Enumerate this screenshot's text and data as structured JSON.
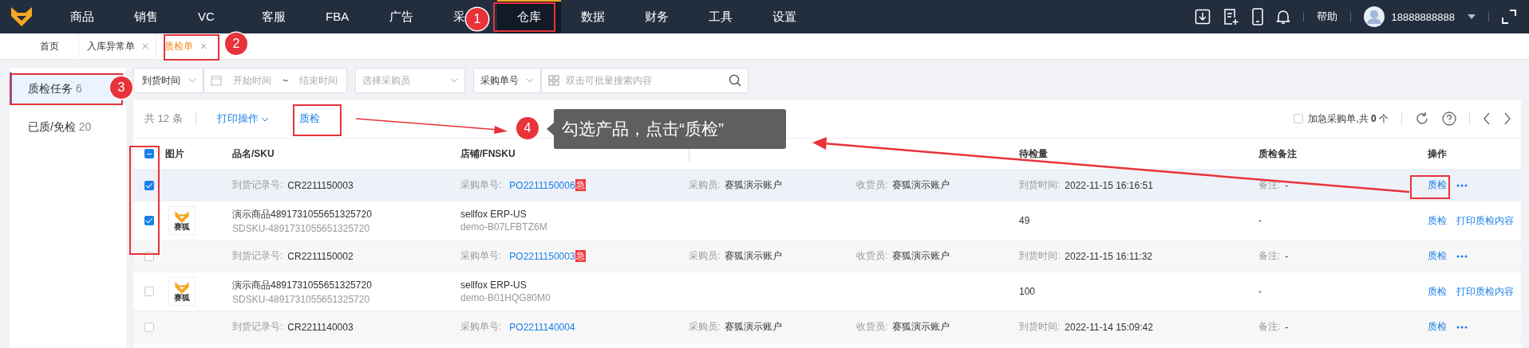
{
  "nav": {
    "items": [
      {
        "label": "商品",
        "selected": false
      },
      {
        "label": "销售",
        "selected": false
      },
      {
        "label": "VC",
        "selected": false
      },
      {
        "label": "客服",
        "selected": false
      },
      {
        "label": "FBA",
        "selected": false
      },
      {
        "label": "广告",
        "selected": false
      },
      {
        "label": "采",
        "selected": false
      },
      {
        "label": "仓库",
        "selected": true
      },
      {
        "label": "数据",
        "selected": false
      },
      {
        "label": "财务",
        "selected": false
      },
      {
        "label": "工具",
        "selected": false
      },
      {
        "label": "设置",
        "selected": false
      }
    ],
    "help": "帮助",
    "user": "18888888888"
  },
  "tabs": [
    {
      "label": "首页",
      "selected": false,
      "closable": false
    },
    {
      "label": "入库异常单",
      "selected": false,
      "closable": true
    },
    {
      "label": "质检单",
      "selected": true,
      "closable": true
    }
  ],
  "sidebar": {
    "items": [
      {
        "label": "质检任务",
        "count": "6",
        "selected": true
      },
      {
        "label": "已质/免检",
        "count": "20",
        "selected": false
      }
    ]
  },
  "filters": {
    "time_type": "到货时间",
    "start_placeholder": "开始时间",
    "separator": "~",
    "end_placeholder": "结束时间",
    "buyer_placeholder": "选择采购员",
    "search_type": "采购单号",
    "search_placeholder": "双击可批量搜索内容"
  },
  "toolbar": {
    "total": "共 12 条",
    "print": "打印操作",
    "qc": "质检",
    "urgent": {
      "checked": false,
      "label": "加急采购单,共 **0** 个"
    }
  },
  "table": {
    "select_all": {
      "indeterminate": true
    },
    "columns": [
      "图片",
      "品名/SKU",
      "店铺/FNSKU",
      "待检量",
      "质检备注",
      "操作"
    ],
    "rows": [
      {
        "kind": "group",
        "checked": true,
        "record_label": "到货记录号:",
        "record": "CR2211150003",
        "po_label": "采购单号:",
        "po": "PO2211150006",
        "urgent": "急",
        "buyer_label": "采购员:",
        "buyer": "赛狐演示账户",
        "receiver_label": "收货员:",
        "receiver": "赛狐演示账户",
        "time_label": "到货时间:",
        "time": "2022-11-15 16:16:51",
        "note_label": "备注:",
        "note": "-",
        "actions": [
          "质检"
        ]
      },
      {
        "kind": "item",
        "checked": true,
        "thumb_caption": "赛狐",
        "name": "演示商品4891731055651325720",
        "sku": "SDSKU-4891731055651325720",
        "store": "sellfox ERP-US",
        "fnsku": "demo-B07LFBTZ6M",
        "qty": "49",
        "note": "-",
        "actions": [
          "质检",
          "打印质检内容"
        ]
      },
      {
        "kind": "group",
        "checked": false,
        "record_label": "到货记录号:",
        "record": "CR2211150002",
        "po_label": "采购单号:",
        "po": "PO2211150003",
        "urgent": "急",
        "buyer_label": "采购员:",
        "buyer": "赛狐演示账户",
        "receiver_label": "收货员:",
        "receiver": "赛狐演示账户",
        "time_label": "到货时间:",
        "time": "2022-11-15 16:11:32",
        "note_label": "备注:",
        "note": "-",
        "actions": [
          "质检"
        ]
      },
      {
        "kind": "item",
        "checked": false,
        "thumb_caption": "赛狐",
        "name": "演示商品4891731055651325720",
        "sku": "SDSKU-4891731055651325720",
        "store": "sellfox ERP-US",
        "fnsku": "demo-B01HQG80M0",
        "qty": "100",
        "note": "-",
        "actions": [
          "质检",
          "打印质检内容"
        ]
      },
      {
        "kind": "group",
        "checked": false,
        "record_label": "到货记录号:",
        "record": "CR2211140003",
        "po_label": "采购单号:",
        "po": "PO2211140004",
        "buyer_label": "采购员:",
        "buyer": "赛狐演示账户",
        "receiver_label": "收货员:",
        "receiver": "赛狐演示账户",
        "time_label": "到货时间:",
        "time": "2022-11-14 15:09:42",
        "note_label": "备注:",
        "note": "-",
        "actions": [
          "质检"
        ]
      }
    ]
  },
  "steps": [
    "1",
    "2",
    "3",
    "4"
  ],
  "callout": "勾选产品，点击“质检”"
}
